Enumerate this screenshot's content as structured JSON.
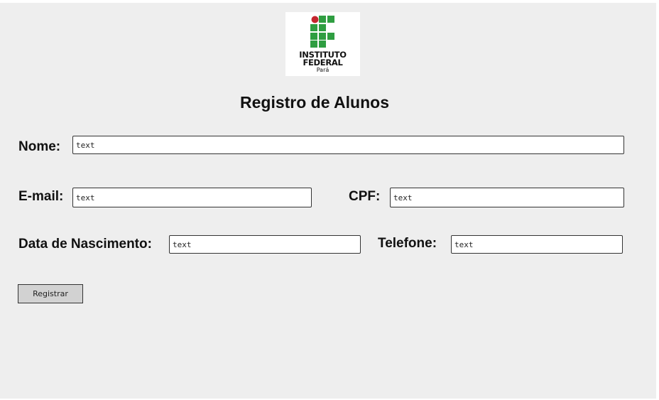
{
  "logo": {
    "line1": "INSTITUTO",
    "line2": "FEDERAL",
    "line3": "Pará",
    "colors": {
      "red": "#c4262e",
      "green": "#2f9e41"
    }
  },
  "page_title": "Registro de Alunos",
  "form": {
    "nome": {
      "label": "Nome:",
      "placeholder": "text"
    },
    "email": {
      "label": "E-mail:",
      "placeholder": "text"
    },
    "cpf": {
      "label": "CPF:",
      "placeholder": "text"
    },
    "data_nascimento": {
      "label": "Data de Nascimento:",
      "placeholder": "text"
    },
    "telefone": {
      "label": "Telefone:",
      "placeholder": "text"
    },
    "submit_label": "Registrar"
  }
}
